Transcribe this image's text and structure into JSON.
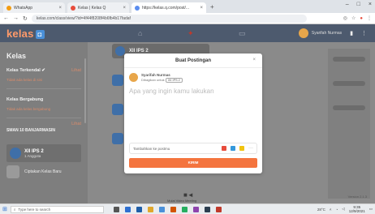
{
  "browser": {
    "tabs": [
      {
        "label": "WhatsApp"
      },
      {
        "label": "Kelas | Kelas Q"
      },
      {
        "label": "https://kelas.q.com/post/..."
      }
    ],
    "url": "kelas.com/class/view/?id=4f44f8208f4b6fb4b17fadaf"
  },
  "app": {
    "logo": "kelas",
    "user_name": "Syarifah Nurmas"
  },
  "sidebar": {
    "title": "Kelas",
    "sections": [
      {
        "label": "Kelas Terkendal ✔",
        "more": "Lihat",
        "sub": "Tidak ada kelas di sini"
      },
      {
        "label": "Kelas Bergabung",
        "more": "",
        "sub": "Tidak ada kelas bergabung"
      }
    ],
    "school": "SMAN 10 BANJARMASIN",
    "school_more": "Lihat",
    "class_item": {
      "name": "XII IPS 2",
      "sub": "1 Anggota"
    },
    "create_label": "Ciptakan Kelas Baru"
  },
  "main": {
    "class_name": "XII IPS 2",
    "camera_label": "Mulai Video Meeting",
    "version": "Version 2.1.3"
  },
  "modal": {
    "title": "Buat Postingan",
    "author_name": "Syarifah Nurmas",
    "shared_with": "Dibagikan untuk",
    "class_tag": "XII IPS 2",
    "composer_placeholder": "Apa yang ingin kamu lakukan",
    "attach_label": "Tambahkan ke postmu",
    "submit_label": "KIRIM",
    "colors": {
      "accent": "#f4743e",
      "attach_red": "#e74c3c",
      "attach_blue": "#3498db",
      "attach_yellow": "#f1c40f"
    }
  },
  "taskbar": {
    "search_placeholder": "Type here to search",
    "weather": "28°C",
    "time": "9:35",
    "date": "12/9/2021"
  }
}
